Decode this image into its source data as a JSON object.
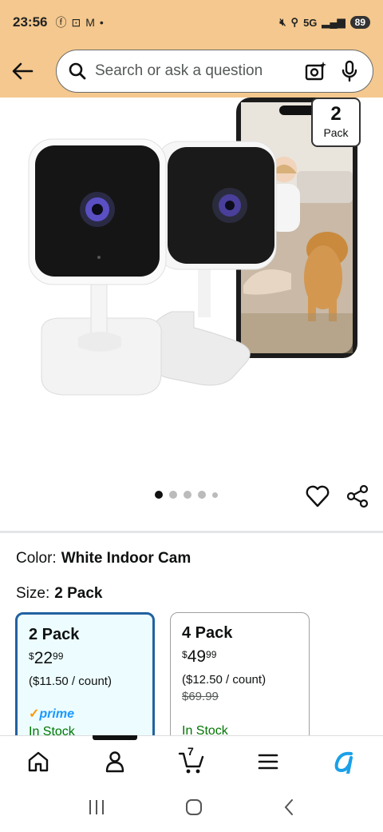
{
  "status": {
    "time": "23:56",
    "network": "5G",
    "battery": "89"
  },
  "search": {
    "placeholder": "Search or ask a question"
  },
  "product": {
    "badge_number": "2",
    "badge_text": "Pack",
    "image_count": 5,
    "active_image": 1
  },
  "color": {
    "label": "Color:",
    "value": "White Indoor Cam"
  },
  "size": {
    "label": "Size:",
    "value": "2 Pack"
  },
  "options": [
    {
      "name": "2 Pack",
      "price_whole": "22",
      "price_fraction": "99",
      "currency": "$",
      "unit_price": "($11.50 / count)",
      "prime": "prime",
      "stock": "In Stock"
    },
    {
      "name": "4 Pack",
      "price_whole": "49",
      "price_fraction": "99",
      "currency": "$",
      "unit_price": "($12.50 / count)",
      "list_price": "$69.99",
      "stock": "In Stock"
    }
  ],
  "nav": {
    "cart_count": "7"
  },
  "colors": {
    "header_bg": "#f4c88e",
    "selected_border": "#2162a1",
    "prime_blue": "#1a98ff",
    "in_stock": "#007600"
  }
}
